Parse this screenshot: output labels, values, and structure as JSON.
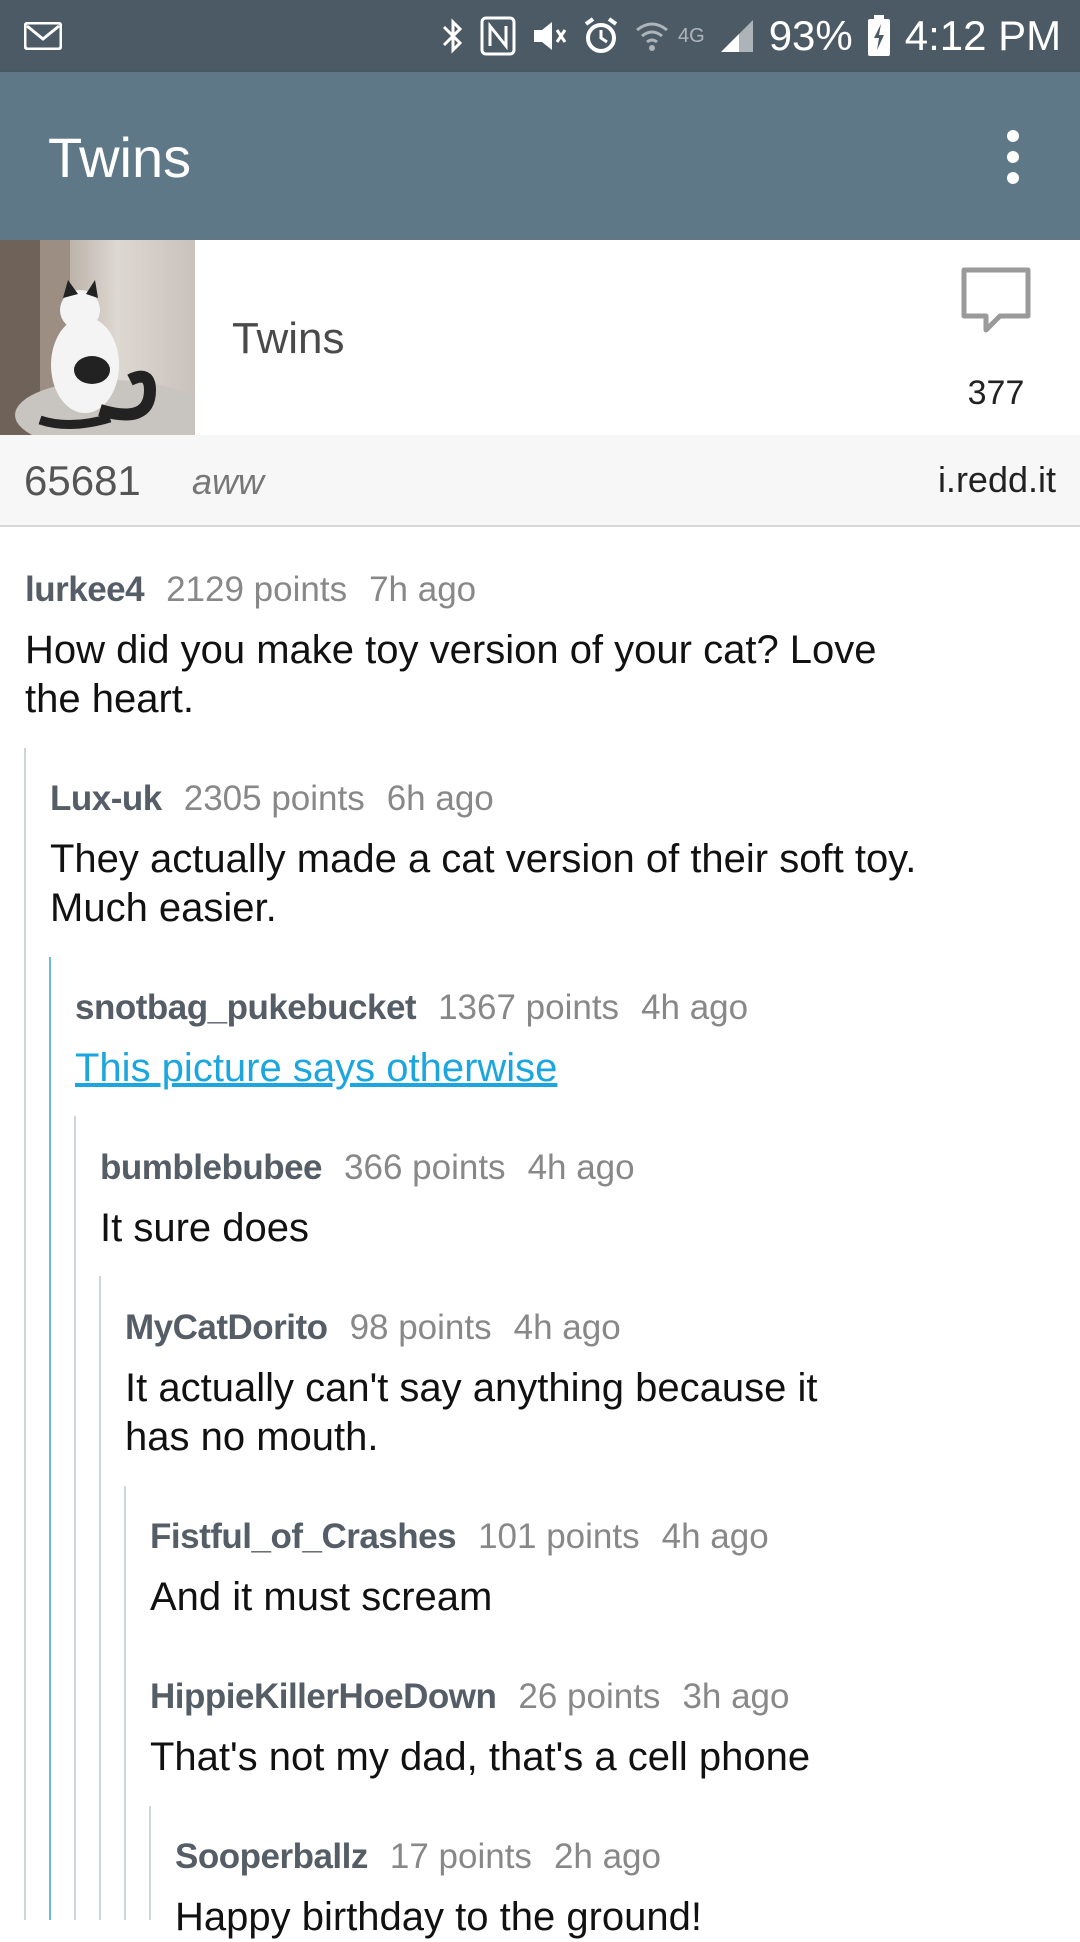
{
  "status_bar": {
    "battery": "93%",
    "time": "4:12 PM",
    "network": "4G",
    "icons": [
      "mail-icon",
      "bluetooth-icon",
      "nfc-icon",
      "mute-icon",
      "alarm-icon",
      "wifi-icon",
      "signal-icon",
      "battery-charging-icon"
    ]
  },
  "app_bar": {
    "title": "Twins",
    "menu_icon": "overflow-menu-icon"
  },
  "post": {
    "title": "Twins",
    "comment_count": "377",
    "score": "65681",
    "subreddit": "aww",
    "domain": "i.redd.it"
  },
  "comments": [
    {
      "author": "lurkee4",
      "points": "2129 points",
      "age": "7h ago",
      "body": "How did you make toy version of your cat? Love the heart."
    },
    {
      "author": "Lux-uk",
      "points": "2305 points",
      "age": "6h ago",
      "body": "They actually made a cat version of their soft toy. Much easier."
    },
    {
      "author": "snotbag_pukebucket",
      "points": "1367 points",
      "age": "4h ago",
      "body": "This picture says otherwise"
    },
    {
      "author": "bumblebubee",
      "points": "366 points",
      "age": "4h ago",
      "body": "It sure does"
    },
    {
      "author": "MyCatDorito",
      "points": "98 points",
      "age": "4h ago",
      "body": "It actually can't say anything because it has no mouth."
    },
    {
      "author": "Fistful_of_Crashes",
      "points": "101 points",
      "age": "4h ago",
      "body": "And it must scream"
    },
    {
      "author": "HippieKillerHoeDown",
      "points": "26 points",
      "age": "3h ago",
      "body": "That's not my dad, that's a cell phone"
    },
    {
      "author": "Sooperballz",
      "points": "17 points",
      "age": "2h ago",
      "body": "Happy birthday to the ground!"
    }
  ],
  "colors": {
    "status_bar": "#4b5a64",
    "app_bar": "#5f7887",
    "link": "#1ca6e0",
    "thread_line": "#cfd6da"
  }
}
